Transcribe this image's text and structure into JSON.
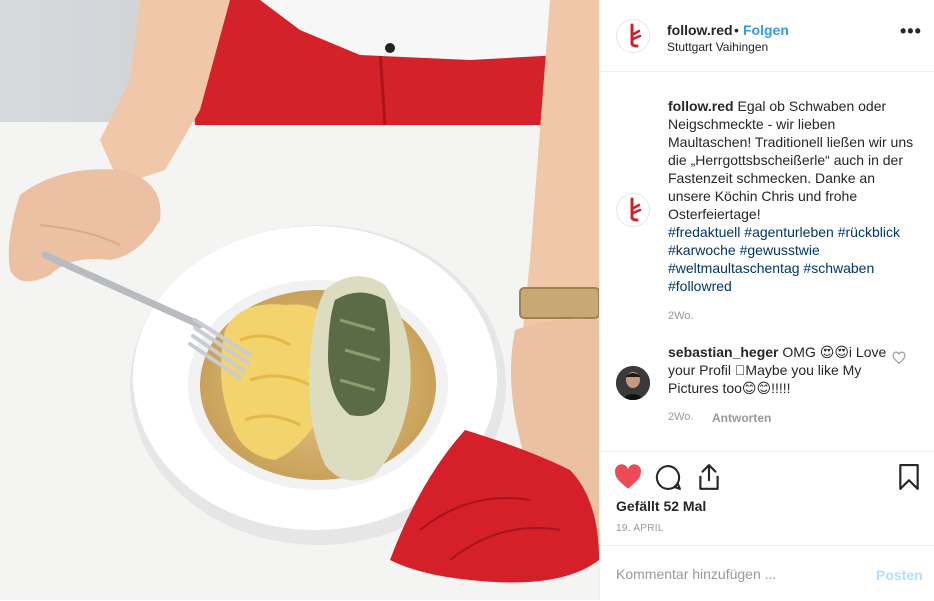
{
  "header": {
    "username": "follow.red",
    "separator": "•",
    "follow_label": "Folgen",
    "location": "Stuttgart Vaihingen",
    "more_label": "•••"
  },
  "caption": {
    "username": "follow.red",
    "text": "Egal ob Schwaben oder Neigschmeckte - wir lieben Maultaschen! Traditionell ließen wir uns die „Herrgottsbscheißerle“ auch in der Fastenzeit schmecken. Danke an unsere Köchin Chris und frohe Osterfeiertage!",
    "hashtags": [
      "#fredaktuell",
      "#agenturleben",
      "#rückblick",
      "#karwoche",
      "#gewusstwie",
      "#weltmaultaschentag",
      "#schwaben",
      "#followred"
    ],
    "time": "2Wo."
  },
  "comment": {
    "username": "sebastian_heger",
    "text": "OMG 😍😍i Love your Profil \u0000Maybe you like My Pictures too😊😊!!!!!",
    "time": "2Wo.",
    "reply_label": "Antworten"
  },
  "actions": {
    "likes": "Gefällt 52 Mal",
    "date": "19. APRIL",
    "liked": true
  },
  "comment_box": {
    "placeholder": "Kommentar hinzufügen ...",
    "post_label": "Posten"
  },
  "colors": {
    "link": "#3897f0",
    "hashtag": "#003569",
    "heart": "#ed4956",
    "brand_red": "#d0202a"
  }
}
